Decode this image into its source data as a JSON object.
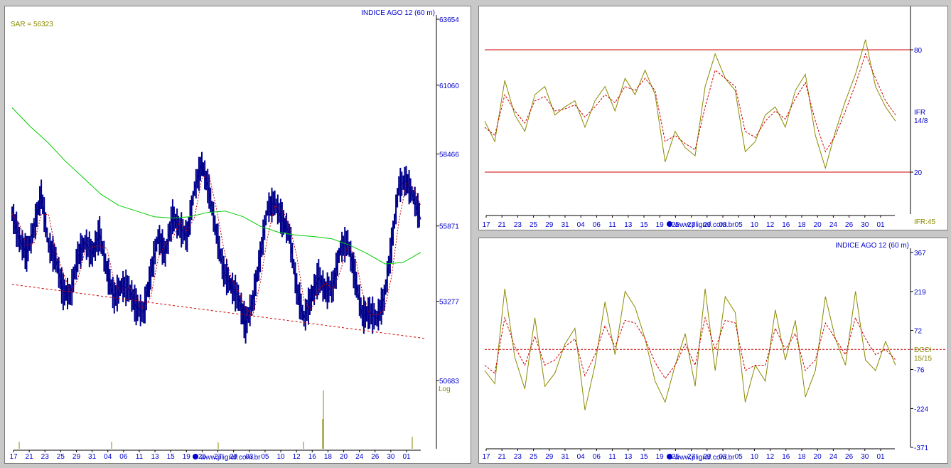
{
  "colors": {
    "price": "#00008b",
    "sar": "#cc0000",
    "ma_long": "#00cc00",
    "oscillator": "#8a8a00",
    "signal": "#cc0000",
    "label_blue": "#0000cc",
    "label_olive": "#8a8a00",
    "level_line": "#cc0000"
  },
  "x_tick_labels": [
    "17",
    "21",
    "23",
    "25",
    "29",
    "31",
    "04",
    "06",
    "11",
    "13",
    "15",
    "19",
    "25",
    "27",
    "29",
    "03",
    "05",
    "10",
    "12",
    "16",
    "18",
    "20",
    "24",
    "26",
    "30",
    "01"
  ],
  "footer_watermark": "www.pligraf.com.br",
  "main": {
    "title": "INDICE AGO 12 (60 m)",
    "sar_label": "SAR = 56323",
    "scale_label": "Log",
    "y_ticks": [
      "63654",
      "61060",
      "58466",
      "55871",
      "53277",
      "50683"
    ]
  },
  "ifr": {
    "name_label": "IFR",
    "params_label": "14/8",
    "bottom_label": "IFR:45",
    "y_ticks": [
      "80",
      "20"
    ]
  },
  "dcci": {
    "title": "INDICE AGO 12 (60 m)",
    "name_label": "DCCI",
    "params_label": "15/15",
    "y_ticks": [
      "367",
      "219",
      "72",
      "-76",
      "-224",
      "-371"
    ]
  },
  "chart_data": [
    {
      "type": "line",
      "title": "INDICE AGO 12 (60 m)",
      "annotations": [
        "SAR = 56323"
      ],
      "x_tick_labels": [
        "17",
        "21",
        "23",
        "25",
        "29",
        "31",
        "04",
        "06",
        "11",
        "13",
        "15",
        "19",
        "25",
        "27",
        "29",
        "03",
        "05",
        "10",
        "12",
        "16",
        "18",
        "20",
        "24",
        "26",
        "30",
        "01"
      ],
      "y_scale": "log",
      "ylim": [
        50683,
        63654
      ],
      "grid": false,
      "series": [
        {
          "key": "price",
          "values": [
            56300,
            55400,
            54900,
            55800,
            57000,
            55200,
            54700,
            53600,
            53500,
            54800,
            55300,
            54900,
            55600,
            54300,
            53400,
            53800,
            53700,
            53100,
            52900,
            54200,
            55500,
            54900,
            56200,
            55800,
            55500,
            57200,
            58100,
            57100,
            55600,
            54300,
            53800,
            53400,
            52500,
            53300,
            54800,
            56500,
            56700,
            56100,
            55600,
            53700,
            52700,
            53400,
            54100,
            53600,
            53800,
            55100,
            55300,
            54100,
            52800,
            52900,
            52700,
            53400,
            55200,
            57300,
            57500,
            56900,
            56100
          ]
        },
        {
          "key": "trend_line",
          "values": [
            53850,
            52050
          ]
        },
        {
          "key": "ma_long",
          "values": [
            60200,
            59500,
            58900,
            58200,
            57600,
            57000,
            56600,
            56400,
            56200,
            56150,
            56200,
            56350,
            56400,
            56200,
            55850,
            55650,
            55550,
            55500,
            55420,
            55200,
            54900,
            54550,
            54600,
            54950
          ]
        }
      ]
    },
    {
      "type": "line",
      "x_tick_labels": [
        "17",
        "21",
        "23",
        "25",
        "29",
        "31",
        "04",
        "06",
        "11",
        "13",
        "15",
        "19",
        "25",
        "27",
        "29",
        "03",
        "05",
        "10",
        "12",
        "16",
        "18",
        "20",
        "24",
        "26",
        "30",
        "01"
      ],
      "ylim": [
        0,
        100
      ],
      "reference_lines": [
        80,
        20
      ],
      "series": [
        {
          "key": "ifr",
          "values": [
            45,
            35,
            65,
            48,
            40,
            58,
            62,
            48,
            52,
            55,
            42,
            55,
            62,
            50,
            66,
            58,
            70,
            58,
            25,
            40,
            32,
            28,
            62,
            78,
            66,
            60,
            30,
            35,
            48,
            52,
            42,
            60,
            68,
            38,
            22,
            40,
            55,
            68,
            85,
            62,
            52,
            45
          ]
        },
        {
          "key": "ifr_signal",
          "values": [
            42,
            38,
            58,
            50,
            44,
            55,
            57,
            50,
            51,
            53,
            47,
            52,
            58,
            54,
            62,
            60,
            66,
            60,
            35,
            38,
            34,
            31,
            52,
            70,
            66,
            62,
            40,
            37,
            45,
            50,
            46,
            56,
            64,
            45,
            30,
            38,
            50,
            63,
            78,
            66,
            55,
            48
          ]
        }
      ]
    },
    {
      "type": "line",
      "title": "INDICE AGO 12 (60 m)",
      "x_tick_labels": [
        "17",
        "21",
        "23",
        "25",
        "29",
        "31",
        "04",
        "06",
        "11",
        "13",
        "15",
        "19",
        "25",
        "27",
        "29",
        "03",
        "05",
        "10",
        "12",
        "16",
        "18",
        "20",
        "24",
        "26",
        "30",
        "01"
      ],
      "ylim": [
        -371,
        367
      ],
      "reference_lines": [
        0
      ],
      "series": [
        {
          "key": "dcci",
          "values": [
            -80,
            -130,
            230,
            -30,
            -150,
            120,
            -140,
            -90,
            20,
            80,
            -230,
            -60,
            180,
            -20,
            220,
            160,
            40,
            -120,
            -200,
            -60,
            60,
            -140,
            230,
            -80,
            200,
            140,
            -200,
            -60,
            -120,
            150,
            -40,
            110,
            -180,
            -80,
            200,
            40,
            -60,
            220,
            -40,
            -80,
            30,
            -60
          ]
        },
        {
          "key": "dcci_signal",
          "values": [
            -60,
            -90,
            120,
            10,
            -60,
            50,
            -60,
            -40,
            10,
            40,
            -100,
            -20,
            90,
            10,
            110,
            100,
            40,
            -50,
            -110,
            -60,
            20,
            -60,
            120,
            0,
            110,
            100,
            -80,
            -60,
            -60,
            80,
            0,
            60,
            -80,
            -40,
            100,
            40,
            -20,
            120,
            40,
            -20,
            0,
            -40
          ]
        }
      ]
    }
  ]
}
